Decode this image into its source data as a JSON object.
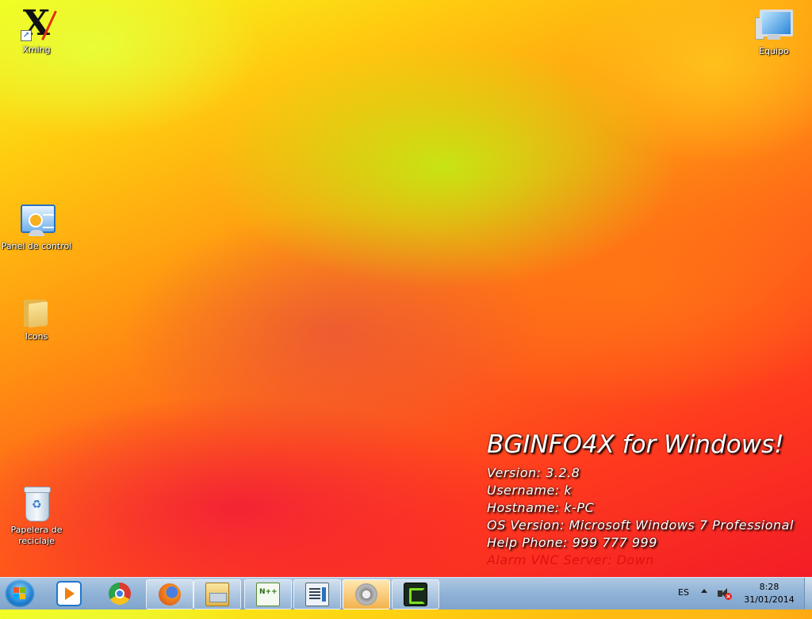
{
  "desktop": {
    "icons": [
      {
        "label": "Xming",
        "icon": "xming-icon"
      },
      {
        "label": "Equipo",
        "icon": "computer-icon"
      },
      {
        "label": "Panel de control",
        "icon": "control-panel-icon"
      },
      {
        "label": "Icons",
        "icon": "folder-icon"
      },
      {
        "label": "Papelera de reciclaje",
        "icon": "recycle-bin-icon"
      }
    ]
  },
  "bginfo": {
    "title": "BGINFO4X for Windows!",
    "lines": [
      "Version: 3.2.8",
      "Username: k",
      "Hostname: k-PC",
      "OS Version: Microsoft Windows 7 Professional",
      "Help Phone: 999 777 999",
      "Alarm VNC Server: Down"
    ],
    "alarm_color": "#e01010"
  },
  "taskbar": {
    "start_icon": "windows-start-icon",
    "apps": [
      {
        "name": "Windows Media Player",
        "icon": "media-player-icon",
        "state": "pinned"
      },
      {
        "name": "Google Chrome",
        "icon": "chrome-icon",
        "state": "pinned"
      },
      {
        "name": "Firefox",
        "icon": "firefox-icon",
        "state": "open"
      },
      {
        "name": "Windows Explorer",
        "icon": "explorer-icon",
        "state": "open"
      },
      {
        "name": "Notepad++",
        "icon": "notepad-plus-plus-icon",
        "state": "open"
      },
      {
        "name": "Window",
        "icon": "window-icon",
        "state": "open"
      },
      {
        "name": "Settings",
        "icon": "settings-icon",
        "state": "active"
      },
      {
        "name": "Greenshot",
        "icon": "greenshot-icon",
        "state": "open"
      }
    ],
    "tray": {
      "language": "ES",
      "time": "8:28",
      "date": "31/01/2014"
    }
  }
}
